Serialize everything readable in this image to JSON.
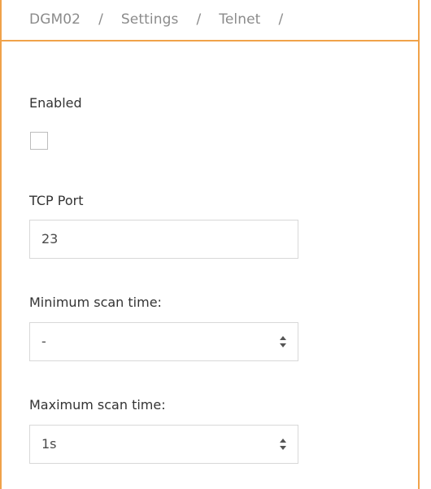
{
  "breadcrumb": {
    "items": [
      "DGM02",
      "Settings",
      "Telnet"
    ],
    "separator": "/"
  },
  "form": {
    "enabled": {
      "label": "Enabled",
      "checked": false
    },
    "tcp_port": {
      "label": "TCP Port",
      "value": "23"
    },
    "min_scan_time": {
      "label": "Minimum scan time:",
      "value": "-",
      "icon": "spinner-arrows-icon"
    },
    "max_scan_time": {
      "label": "Maximum scan time:",
      "value": "1s",
      "icon": "spinner-arrows-icon"
    }
  },
  "colors": {
    "accent": "#f0a24a",
    "border": "#d8d8d8",
    "text": "#333333",
    "muted": "#8b8b8b"
  }
}
